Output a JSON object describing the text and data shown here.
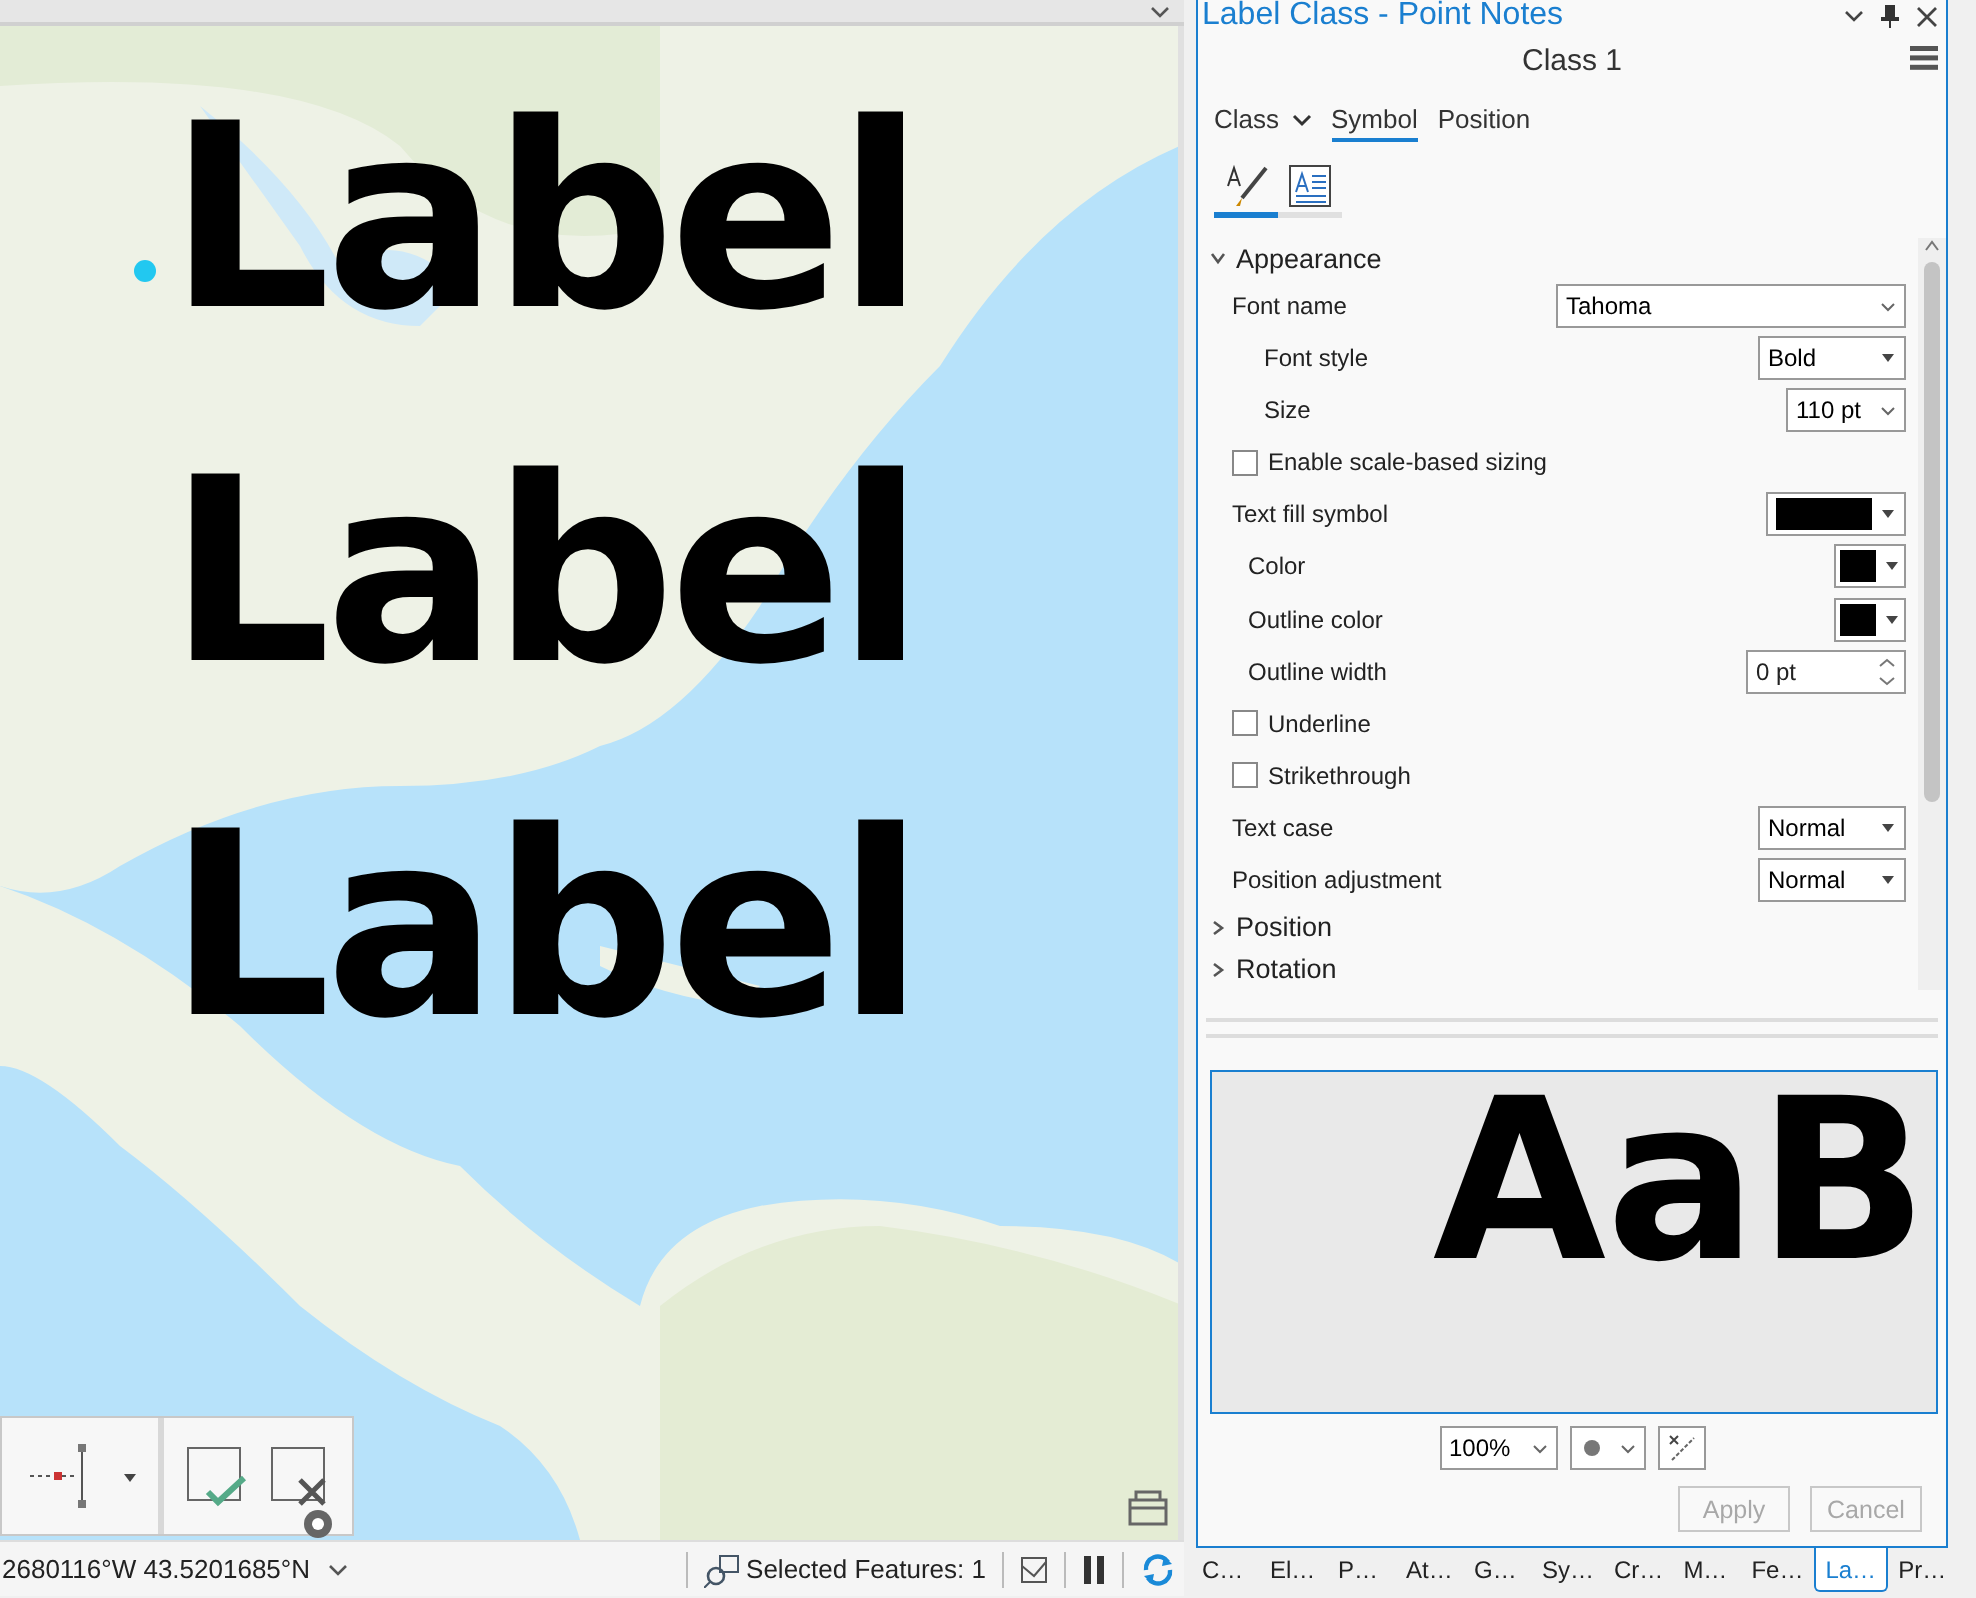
{
  "map": {
    "labels": [
      "Label",
      "Label",
      "Label"
    ],
    "coordinates": "2680116°W 43.5201685°N",
    "selected_features": "Selected Features: 1"
  },
  "panel": {
    "title": "Label Class - Point Notes",
    "class_name": "Class 1",
    "tabs": [
      {
        "label": "Class",
        "selected": false,
        "kind": "dropdown"
      },
      {
        "label": "Symbol",
        "selected": true,
        "kind": "plain"
      },
      {
        "label": "Position",
        "selected": false,
        "kind": "plain"
      }
    ],
    "subtabs": [
      {
        "kind": "brush",
        "selected": true
      },
      {
        "kind": "text",
        "selected": false
      }
    ],
    "sections": [
      {
        "title": "Appearance",
        "expanded": true,
        "properties": [
          {
            "kind": "combo",
            "label": "Font name",
            "value": "Tahoma",
            "children": [
              {
                "kind": "dropdown",
                "label": "Font style",
                "value": "Bold"
              },
              {
                "kind": "combo",
                "label": "Size",
                "value": "110 pt"
              }
            ]
          },
          {
            "kind": "checkbox",
            "label": "Enable scale-based sizing",
            "checked": false
          },
          {
            "kind": "swatch",
            "label": "Text fill symbol",
            "color": "#000000",
            "children": [
              {
                "kind": "swatch",
                "label": "Color",
                "color": "#000000"
              },
              {
                "kind": "swatch",
                "label": "Outline color",
                "color": "#000000"
              },
              {
                "kind": "spinner",
                "label": "Outline width",
                "value": "0 pt"
              }
            ]
          },
          {
            "kind": "checkbox",
            "label": "Underline",
            "checked": false
          },
          {
            "kind": "checkbox",
            "label": "Strikethrough",
            "checked": false
          },
          {
            "kind": "dropdown",
            "label": "Text case",
            "value": "Normal"
          },
          {
            "kind": "dropdown",
            "label": "Position adjustment",
            "value": "Normal"
          }
        ]
      },
      {
        "title": "Position",
        "expanded": false
      },
      {
        "title": "Rotation",
        "expanded": false
      }
    ],
    "preview": {
      "sample": "AaB",
      "zoom": "100%"
    },
    "buttons": [
      {
        "label": "Apply",
        "disabled": true
      },
      {
        "label": "Cancel",
        "disabled": true
      }
    ]
  },
  "bottom_tabs": [
    {
      "label": "C…",
      "selected": false
    },
    {
      "label": "El…",
      "selected": false
    },
    {
      "label": "P…",
      "selected": false
    },
    {
      "label": "At…",
      "selected": false
    },
    {
      "label": "G…",
      "selected": false
    },
    {
      "label": "Sy…",
      "selected": false
    },
    {
      "label": "Cr…",
      "selected": false
    },
    {
      "label": "M…",
      "selected": false
    },
    {
      "label": "Fe…",
      "selected": false
    },
    {
      "label": "La…",
      "selected": true
    },
    {
      "label": "Pr…",
      "selected": false
    }
  ]
}
